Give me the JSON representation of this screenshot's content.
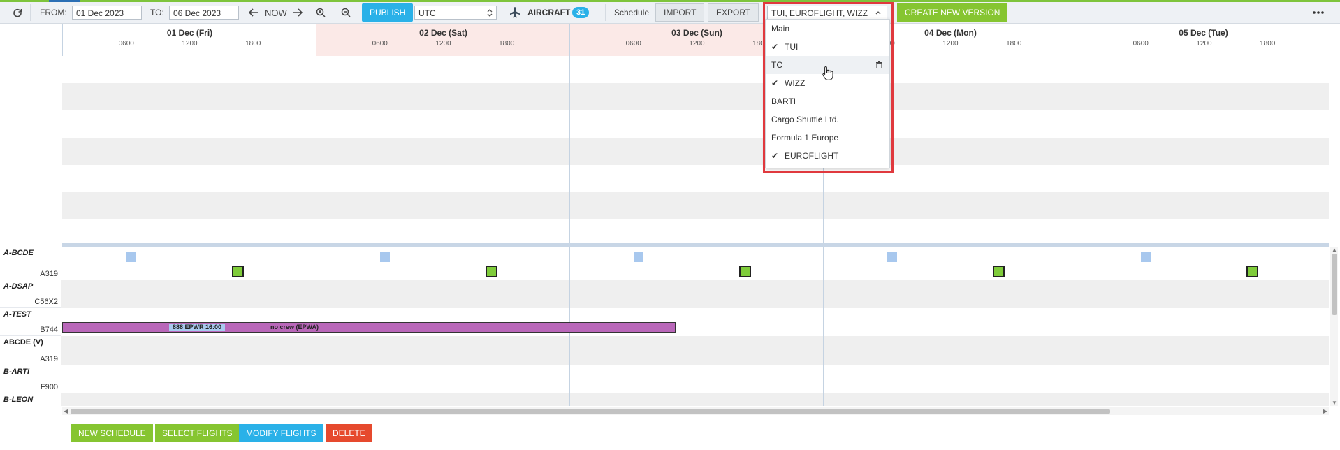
{
  "toolbar": {
    "from_label": "FROM:",
    "from_value": "01 Dec 2023",
    "to_label": "TO:",
    "to_value": "06 Dec 2023",
    "now_label": "NOW",
    "publish_label": "PUBLISH",
    "timezone_value": "UTC",
    "aircraft_label": "AIRCRAFT",
    "aircraft_count": "31",
    "schedule_label": "Schedule",
    "import_label": "IMPORT",
    "export_label": "EXPORT",
    "versions_value": "TUI, EUROFLIGHT, WIZZ",
    "create_version_label": "CREATE NEW VERSION",
    "more_icon": "ellipsis-icon"
  },
  "timeline": {
    "days": [
      {
        "title": "01 Dec (Fri)",
        "weekend": false
      },
      {
        "title": "02 Dec (Sat)",
        "weekend": true
      },
      {
        "title": "03 Dec (Sun)",
        "weekend": true
      },
      {
        "title": "04 Dec (Mon)",
        "weekend": false
      },
      {
        "title": "05 Dec (Tue)",
        "weekend": false
      }
    ],
    "ticks": [
      "0600",
      "1200",
      "1800"
    ]
  },
  "aircraft": [
    {
      "reg": "A-BCDE",
      "type": "A319"
    },
    {
      "reg": "A-DSAP",
      "type": "C56X2"
    },
    {
      "reg": "A-TEST",
      "type": "B744"
    },
    {
      "reg": "ABCDE (V)",
      "type": "A319"
    },
    {
      "reg": "B-ARTI",
      "type": "F900"
    },
    {
      "reg": "B-LEON",
      "type": ""
    }
  ],
  "flight_bar": {
    "tag": "888  EPWR 16:00",
    "text": "no crew (EPWA)",
    "color": "#b967b9"
  },
  "bottom_buttons": {
    "new_schedule": "NEW SCHEDULE",
    "select_flights": "SELECT FLIGHTS",
    "modify_flights": "MODIFY FLIGHTS",
    "delete": "DELETE"
  },
  "version_dropdown": {
    "items": [
      {
        "label": "Main",
        "checked": false
      },
      {
        "label": "TUI",
        "checked": true
      },
      {
        "label": "TC",
        "checked": false,
        "hovered": true
      },
      {
        "label": "WIZZ",
        "checked": true
      },
      {
        "label": "BARTI",
        "checked": false
      },
      {
        "label": "Cargo Shuttle Ltd.",
        "checked": false
      },
      {
        "label": "Formula 1 Europe",
        "checked": false
      },
      {
        "label": "EUROFLIGHT",
        "checked": true
      }
    ]
  },
  "colors": {
    "accent_blue": "#2ab1e8",
    "accent_green": "#86c531",
    "danger": "#e64a2e",
    "highlight_red": "#e0393e"
  }
}
